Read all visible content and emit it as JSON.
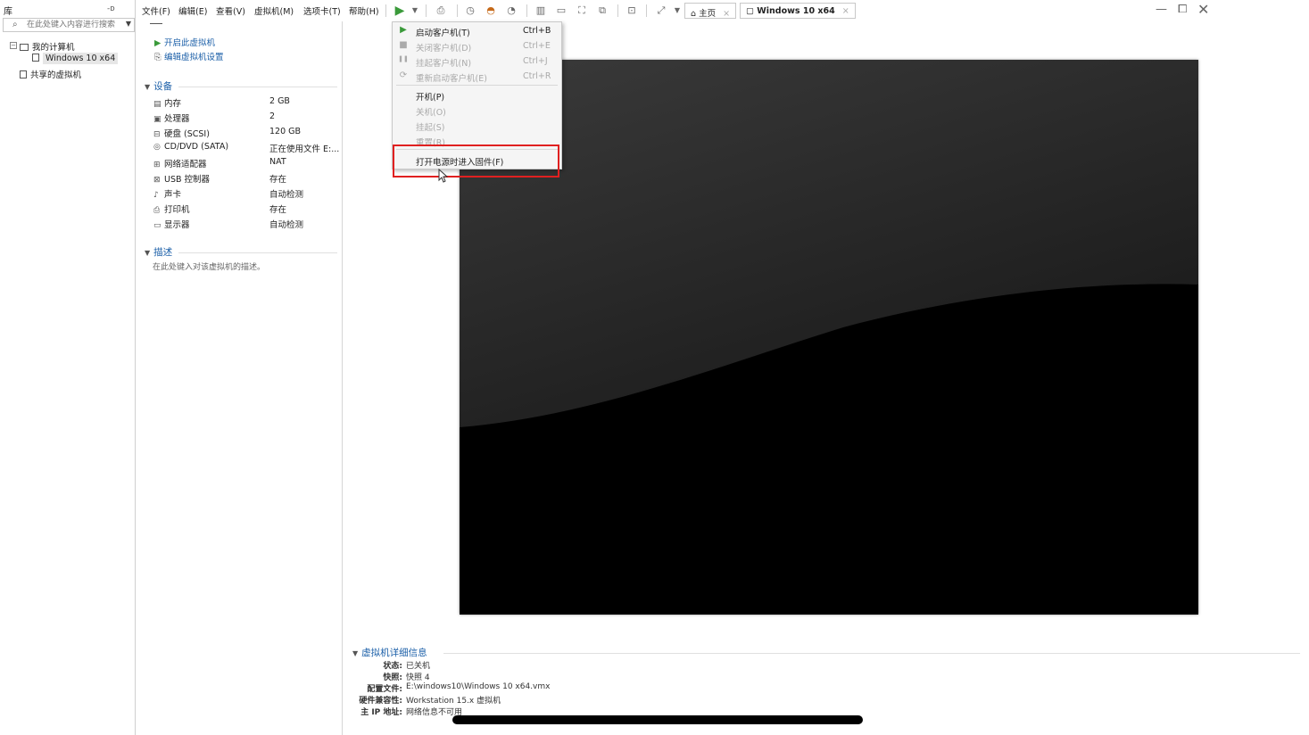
{
  "library": {
    "title": "库",
    "search_placeholder": "在此处键入内容进行搜索",
    "tree": {
      "my_computer": "我的计算机",
      "vm": "Windows 10 x64",
      "shared": "共享的虚拟机"
    }
  },
  "menubar": {
    "items": [
      "文件(F)",
      "编辑(E)",
      "查看(V)",
      "虚拟机(M)",
      "选项卡(T)",
      "帮助(H)"
    ]
  },
  "tabs": {
    "home": "主页",
    "vm": "Windows 10 x64"
  },
  "details": {
    "actions": {
      "power_on": "开启此虚拟机",
      "edit_settings": "编辑虚拟机设置"
    },
    "devices_title": "设备",
    "devices": [
      {
        "icon": "memory-icon",
        "name": "内存",
        "value": "2 GB"
      },
      {
        "icon": "cpu-icon",
        "name": "处理器",
        "value": "2"
      },
      {
        "icon": "disk-icon",
        "name": "硬盘 (SCSI)",
        "value": "120 GB"
      },
      {
        "icon": "cd-icon",
        "name": "CD/DVD (SATA)",
        "value": "正在使用文件 E:..."
      },
      {
        "icon": "network-icon",
        "name": "网络适配器",
        "value": "NAT"
      },
      {
        "icon": "usb-icon",
        "name": "USB 控制器",
        "value": "存在"
      },
      {
        "icon": "sound-icon",
        "name": "声卡",
        "value": "自动检测"
      },
      {
        "icon": "printer-icon",
        "name": "打印机",
        "value": "存在"
      },
      {
        "icon": "display-icon",
        "name": "显示器",
        "value": "自动检测"
      }
    ],
    "description_title": "描述",
    "description_placeholder": "在此处键入对该虚拟机的描述。"
  },
  "dropdown": {
    "items": [
      {
        "icon": "play-icon",
        "label": "启动客户机(T)",
        "shortcut": "Ctrl+B",
        "disabled": false
      },
      {
        "icon": "stop-icon",
        "label": "关闭客户机(D)",
        "shortcut": "Ctrl+E",
        "disabled": true
      },
      {
        "icon": "pause-icon",
        "label": "挂起客户机(N)",
        "shortcut": "Ctrl+J",
        "disabled": true
      },
      {
        "icon": "restart-icon",
        "label": "重新启动客户机(E)",
        "shortcut": "Ctrl+R",
        "disabled": true
      },
      {
        "icon": "",
        "label": "开机(P)",
        "shortcut": "",
        "disabled": false
      },
      {
        "icon": "",
        "label": "关机(O)",
        "shortcut": "",
        "disabled": true
      },
      {
        "icon": "",
        "label": "挂起(S)",
        "shortcut": "",
        "disabled": true
      },
      {
        "icon": "",
        "label": "重置(R)",
        "shortcut": "",
        "disabled": true
      },
      {
        "icon": "",
        "label": "打开电源时进入固件(F)",
        "shortcut": "",
        "disabled": false
      }
    ]
  },
  "vm_info": {
    "title": "虚拟机详细信息",
    "rows": [
      {
        "key": "状态:",
        "value": "已关机"
      },
      {
        "key": "快照:",
        "value": "快照 4"
      },
      {
        "key": "配置文件:",
        "value": "E:\\windows10\\Windows 10 x64.vmx"
      },
      {
        "key": "硬件兼容性:",
        "value": "Workstation 15.x 虚拟机"
      },
      {
        "key": "主 IP 地址:",
        "value": "网络信息不可用"
      }
    ]
  },
  "colors": {
    "link_blue": "#1b5fa8",
    "play_green": "#3a9a3a",
    "highlight_red": "#e02020"
  }
}
